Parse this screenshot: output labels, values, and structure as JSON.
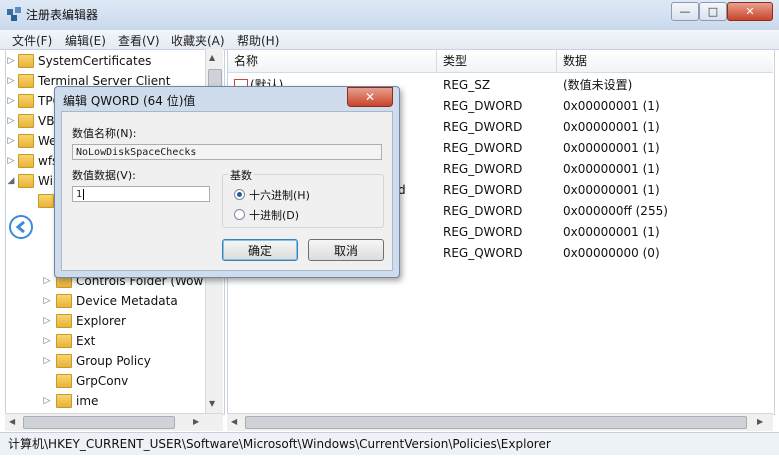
{
  "window": {
    "title": "注册表编辑器",
    "controls": {
      "minimize": "—",
      "maximize": "□",
      "close": "✕"
    }
  },
  "menu": [
    "文件(F)",
    "编辑(E)",
    "查看(V)",
    "收藏夹(A)",
    "帮助(H)"
  ],
  "tree": {
    "items": [
      {
        "label": "SystemCertificates",
        "expander": "▷"
      },
      {
        "label": "Terminal Server Client",
        "expander": "▷"
      },
      {
        "label": "TPG",
        "expander": "▷"
      },
      {
        "label": "VBA",
        "expander": "▷"
      },
      {
        "label": "Web",
        "expander": "▷"
      },
      {
        "label": "wfs",
        "expander": "▷"
      },
      {
        "label": "Win",
        "expander": "◢"
      },
      {
        "label": "Controls Folder (Wow",
        "expander": "▷"
      },
      {
        "label": "Device Metadata",
        "expander": "▷"
      },
      {
        "label": "Explorer",
        "expander": "▷"
      },
      {
        "label": "Ext",
        "expander": "▷"
      },
      {
        "label": "Group Policy",
        "expander": "▷"
      },
      {
        "label": "GrpConv",
        "expander": ""
      },
      {
        "label": "ime",
        "expander": "▷"
      }
    ]
  },
  "list": {
    "headers": {
      "name": "名称",
      "type": "类型",
      "data": "数据"
    },
    "rows": [
      {
        "name": "(默认)",
        "type": "REG_SZ",
        "data": "(数值未设置)"
      },
      {
        "name": "",
        "type": "REG_DWORD",
        "data": "0x00000001 (1)"
      },
      {
        "name": "",
        "type": "REG_DWORD",
        "data": "0x00000001 (1)"
      },
      {
        "name": "",
        "type": "REG_DWORD",
        "data": "0x00000001 (1)"
      },
      {
        "name": "",
        "type": "REG_DWORD",
        "data": "0x00000001 (1)"
      },
      {
        "name": "d",
        "type": "REG_DWORD",
        "data": "0x00000001 (1)"
      },
      {
        "name": "",
        "type": "REG_DWORD",
        "data": "0x000000ff (255)"
      },
      {
        "name": "",
        "type": "REG_DWORD",
        "data": "0x00000001 (1)"
      },
      {
        "name": "",
        "type": "REG_QWORD",
        "data": "0x00000000 (0)"
      }
    ]
  },
  "dialog": {
    "title": "编辑 QWORD (64 位)值",
    "close": "✕",
    "name_label": "数值名称(N):",
    "name_value": "NoLowDiskSpaceChecks",
    "data_label": "数值数据(V):",
    "data_value": "1",
    "base_label": "基数",
    "radio_hex": "十六进制(H)",
    "radio_dec": "十进制(D)",
    "selected_base": "hex",
    "ok": "确定",
    "cancel": "取消"
  },
  "statusbar": {
    "path": "计算机\\HKEY_CURRENT_USER\\Software\\Microsoft\\Windows\\CurrentVersion\\Policies\\Explorer"
  },
  "colors": {
    "accent": "#3a8cd6",
    "titlebar": "#c9d9ec",
    "dialog": "#cfdcec"
  }
}
